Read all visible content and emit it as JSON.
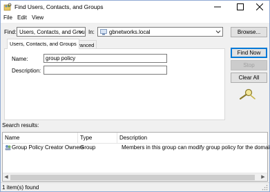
{
  "window": {
    "title": "Find Users, Contacts, and Groups"
  },
  "menu": {
    "items": [
      "File",
      "Edit",
      "View"
    ]
  },
  "find": {
    "find_label": "Find:",
    "find_value": "Users, Contacts, and Groups",
    "in_label": "In:",
    "in_value": "gbnetworks.local",
    "browse_label": "Browse..."
  },
  "tabs": [
    "Users, Contacts, and Groups",
    "Advanced"
  ],
  "form": {
    "name_label": "Name:",
    "name_value": "group policy",
    "description_label": "Description:",
    "description_value": ""
  },
  "buttons": {
    "find_now": "Find Now",
    "stop": "Stop",
    "clear_all": "Clear All"
  },
  "results": {
    "label": "Search results:",
    "columns": [
      "Name",
      "Type",
      "Description"
    ],
    "rows": [
      {
        "name": "Group Policy Creator Owners",
        "type": "Group",
        "description": "Members in this group can modify group policy for the domain"
      }
    ]
  },
  "status": {
    "text": "1 item(s) found"
  },
  "icons": {
    "app": "find-users-icon",
    "search": "magnifier-icon",
    "group": "group-icon"
  }
}
